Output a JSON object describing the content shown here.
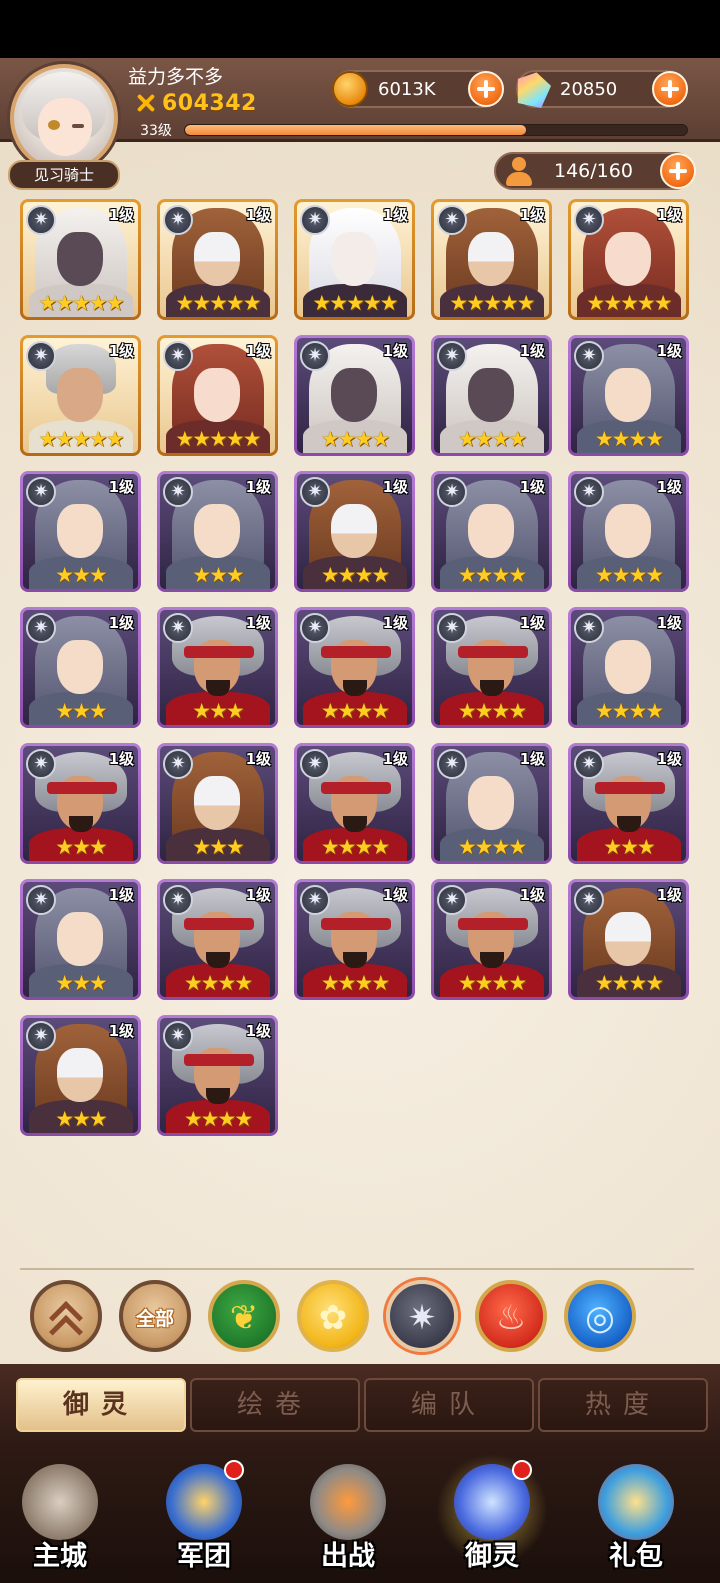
{
  "player": {
    "name": "益力多不多",
    "power": "604342",
    "level_label": "33级",
    "xp_fraction": 0.68,
    "title": "见习骑士"
  },
  "resources": {
    "gold": "6013K",
    "gems": "20850",
    "capacity": "146/160"
  },
  "heroes": [
    {
      "char": "elf",
      "frame": "gold",
      "level": "1级",
      "stars": "★★★★★"
    },
    {
      "char": "mask",
      "frame": "gold",
      "level": "1级",
      "stars": "★★★★★"
    },
    {
      "char": "vamp",
      "frame": "gold",
      "level": "1级",
      "stars": "★★★★★"
    },
    {
      "char": "mask",
      "frame": "gold",
      "level": "1级",
      "stars": "★★★★★"
    },
    {
      "char": "queen",
      "frame": "gold",
      "level": "1级",
      "stars": "★★★★★"
    },
    {
      "char": "old",
      "frame": "gold",
      "level": "1级",
      "stars": "★★★★★"
    },
    {
      "char": "queen",
      "frame": "gold",
      "level": "1级",
      "stars": "★★★★★"
    },
    {
      "char": "elf",
      "frame": "purple",
      "level": "1级",
      "stars": "★★★★"
    },
    {
      "char": "elf",
      "frame": "purple",
      "level": "1级",
      "stars": "★★★★"
    },
    {
      "char": "merman",
      "frame": "purple",
      "level": "1级",
      "stars": "★★★★"
    },
    {
      "char": "merman",
      "frame": "purple",
      "level": "1级",
      "stars": "★★★"
    },
    {
      "char": "merman",
      "frame": "purple",
      "level": "1级",
      "stars": "★★★"
    },
    {
      "char": "mask",
      "frame": "purple",
      "level": "1级",
      "stars": "★★★★"
    },
    {
      "char": "merman",
      "frame": "purple",
      "level": "1级",
      "stars": "★★★★"
    },
    {
      "char": "merman",
      "frame": "purple",
      "level": "1级",
      "stars": "★★★★"
    },
    {
      "char": "merman",
      "frame": "purple",
      "level": "1级",
      "stars": "★★★"
    },
    {
      "char": "warrior",
      "frame": "purple",
      "level": "1级",
      "stars": "★★★"
    },
    {
      "char": "warrior",
      "frame": "purple",
      "level": "1级",
      "stars": "★★★★"
    },
    {
      "char": "warrior",
      "frame": "purple",
      "level": "1级",
      "stars": "★★★★"
    },
    {
      "char": "merman",
      "frame": "purple",
      "level": "1级",
      "stars": "★★★★"
    },
    {
      "char": "warrior",
      "frame": "purple",
      "level": "1级",
      "stars": "★★★"
    },
    {
      "char": "mask",
      "frame": "purple",
      "level": "1级",
      "stars": "★★★"
    },
    {
      "char": "warrior",
      "frame": "purple",
      "level": "1级",
      "stars": "★★★★"
    },
    {
      "char": "merman",
      "frame": "purple",
      "level": "1级",
      "stars": "★★★★"
    },
    {
      "char": "warrior",
      "frame": "purple",
      "level": "1级",
      "stars": "★★★"
    },
    {
      "char": "merman",
      "frame": "purple",
      "level": "1级",
      "stars": "★★★"
    },
    {
      "char": "warrior",
      "frame": "purple",
      "level": "1级",
      "stars": "★★★★"
    },
    {
      "char": "warrior",
      "frame": "purple",
      "level": "1级",
      "stars": "★★★★"
    },
    {
      "char": "warrior",
      "frame": "purple",
      "level": "1级",
      "stars": "★★★★"
    },
    {
      "char": "mask",
      "frame": "purple",
      "level": "1级",
      "stars": "★★★★"
    },
    {
      "char": "mask",
      "frame": "purple",
      "level": "1级",
      "stars": "★★★"
    },
    {
      "char": "warrior",
      "frame": "purple",
      "level": "1级",
      "stars": "★★★★"
    }
  ],
  "filters": {
    "all_label": "全部",
    "items": [
      "collapse-icon",
      "all",
      "nature-faction-icon",
      "rose-faction-icon",
      "dark-star-faction-icon",
      "phoenix-faction-icon",
      "water-faction-icon"
    ],
    "selected": "dark-star-faction-icon"
  },
  "subtabs": [
    "御灵",
    "绘卷",
    "编队",
    "热度"
  ],
  "active_subtab": 0,
  "nav": [
    {
      "label": "主城",
      "icon": "castle-icon",
      "badge": false
    },
    {
      "label": "军团",
      "icon": "legion-fist-icon",
      "badge": true
    },
    {
      "label": "出战",
      "icon": "battle-gate-icon",
      "badge": false
    },
    {
      "label": "御灵",
      "icon": "crystal-icon",
      "badge": true,
      "active": true
    },
    {
      "label": "礼包",
      "icon": "gift-shop-icon",
      "badge": false
    }
  ],
  "colors": {
    "gold_frame": "#e59b2f",
    "purple_frame": "#b57bd6",
    "accent_orange": "#f26b15",
    "power_yellow": "#ffc21a"
  }
}
